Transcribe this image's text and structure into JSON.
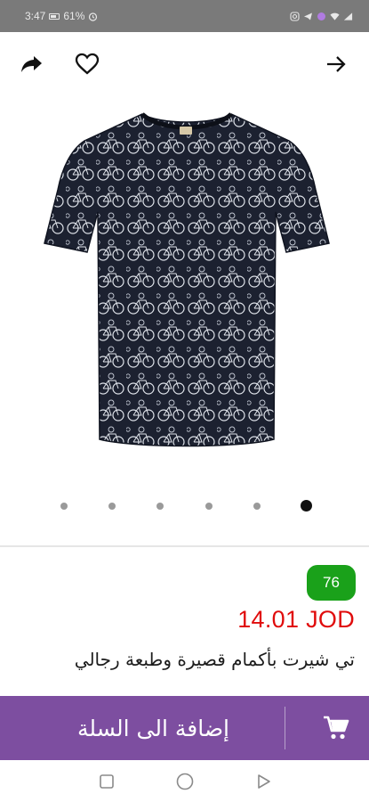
{
  "status_bar": {
    "time": "3:47",
    "battery": "61%"
  },
  "toolbar": {
    "share_icon": "share-icon",
    "favorite_icon": "heart-icon",
    "forward_icon": "arrow-right-icon"
  },
  "gallery": {
    "image_count": 6,
    "active_index": 5
  },
  "product": {
    "rating": "76",
    "rating_color": "#1aa11a",
    "price": "14.01 JOD",
    "price_color": "#e00c0c",
    "title": "تي شيرت بأكمام قصيرة وطبعة رجالي"
  },
  "cart": {
    "label": "إضافة الى السلة",
    "icon": "cart-icon",
    "color": "#7d4ea0"
  },
  "nav": {
    "recents_icon": "square-icon",
    "home_icon": "circle-icon",
    "back_icon": "triangle-back-icon"
  }
}
